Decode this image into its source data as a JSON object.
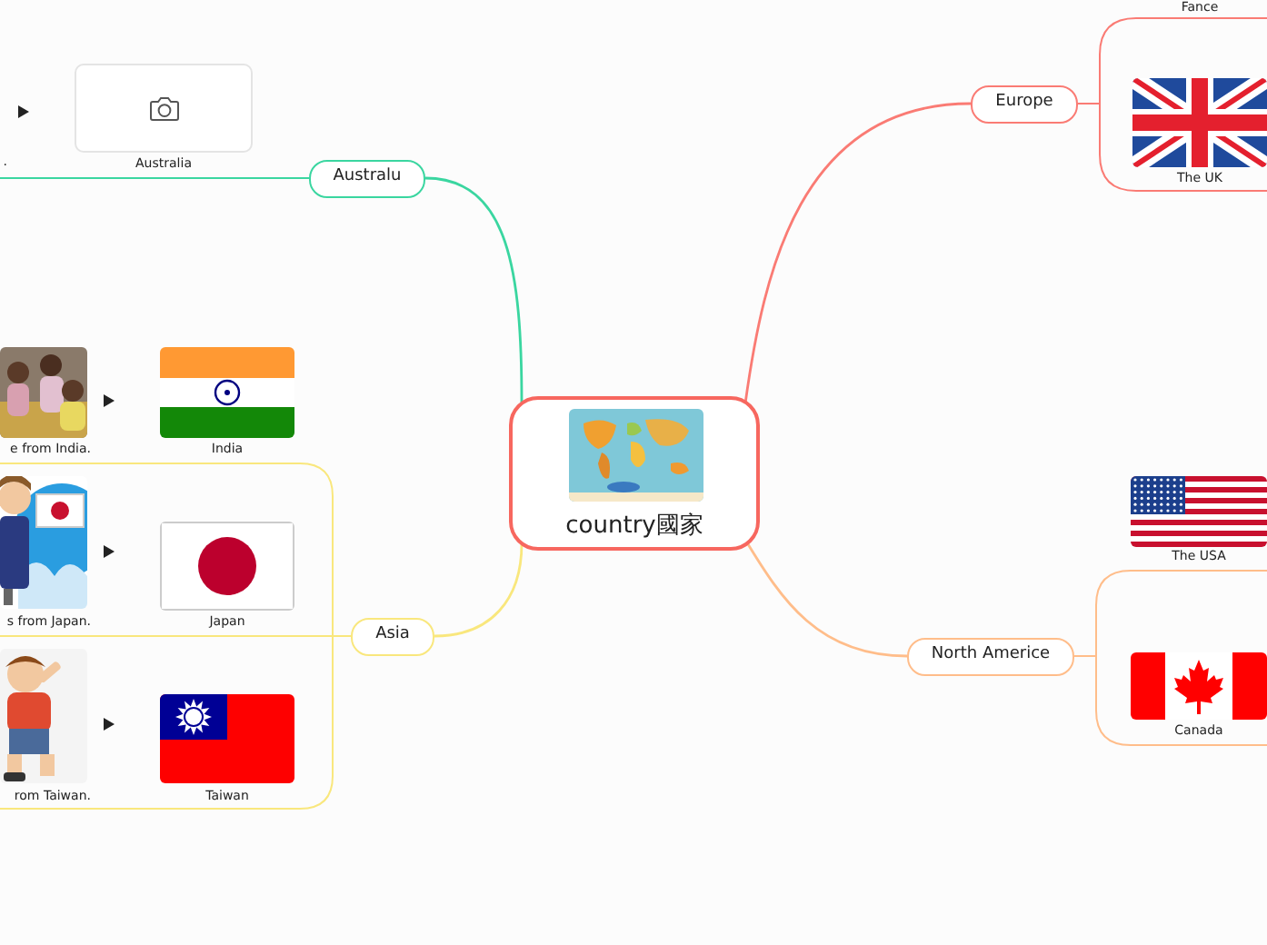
{
  "central_topic": {
    "title": "country國家"
  },
  "branches": [
    {
      "label": "Australu",
      "color": "#3ad6a0",
      "topics": [
        {
          "caption": ".",
          "label": "Australia",
          "kind": "placeholder"
        }
      ]
    },
    {
      "label": "Asia",
      "color": "#f9e77d",
      "topics": [
        {
          "caption": "e from India.",
          "label": "India",
          "kind": "flag"
        },
        {
          "caption": "s from Japan.",
          "label": "Japan",
          "kind": "flag"
        },
        {
          "caption": "rom Taiwan.",
          "label": "Taiwan",
          "kind": "flag"
        }
      ]
    },
    {
      "label": "Europe",
      "color": "#fa7b74",
      "topics": [
        {
          "label": "Fance",
          "kind": "cut"
        },
        {
          "label": "The UK",
          "kind": "flag"
        }
      ]
    },
    {
      "label": "North Americe",
      "color": "#ffbd8a",
      "topics": [
        {
          "label": "The USA",
          "kind": "flag"
        },
        {
          "label": "Canada",
          "kind": "flag"
        }
      ]
    }
  ]
}
